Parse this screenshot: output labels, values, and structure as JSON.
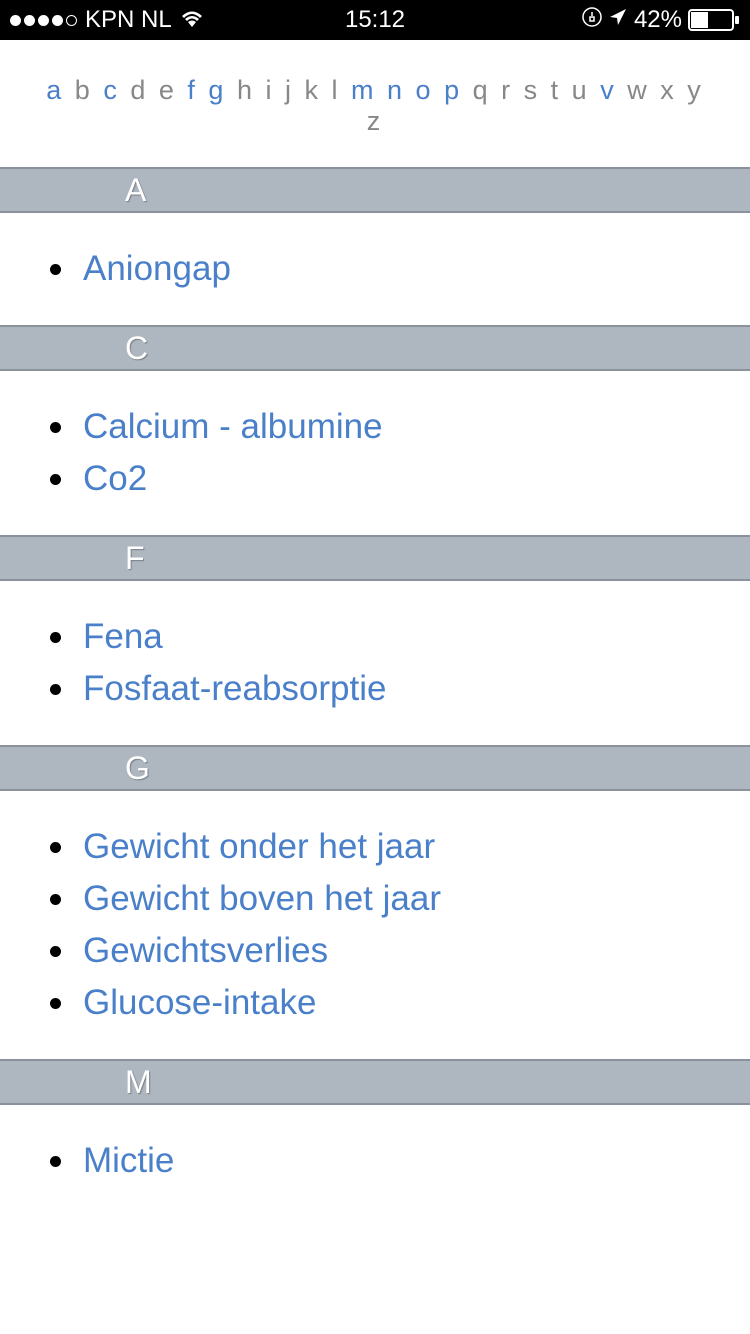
{
  "status_bar": {
    "carrier": "KPN NL",
    "time": "15:12",
    "battery_pct": "42%"
  },
  "alpha_nav": {
    "letters": [
      "a",
      "b",
      "c",
      "d",
      "e",
      "f",
      "g",
      "h",
      "i",
      "j",
      "k",
      "l",
      "m",
      "n",
      "o",
      "p",
      "q",
      "r",
      "s",
      "t",
      "u",
      "v",
      "w",
      "x",
      "y",
      "z"
    ],
    "active": [
      "a",
      "c",
      "f",
      "g",
      "m",
      "n",
      "o",
      "p",
      "v"
    ]
  },
  "sections": [
    {
      "letter": "A",
      "items": [
        "Aniongap"
      ]
    },
    {
      "letter": "C",
      "items": [
        "Calcium - albumine",
        "Co2"
      ]
    },
    {
      "letter": "F",
      "items": [
        "Fena",
        "Fosfaat-reabsorptie"
      ]
    },
    {
      "letter": "G",
      "items": [
        "Gewicht onder het jaar",
        "Gewicht boven het jaar",
        "Gewichtsverlies",
        "Glucose-intake"
      ]
    },
    {
      "letter": "M",
      "items": [
        "Mictie"
      ]
    }
  ]
}
